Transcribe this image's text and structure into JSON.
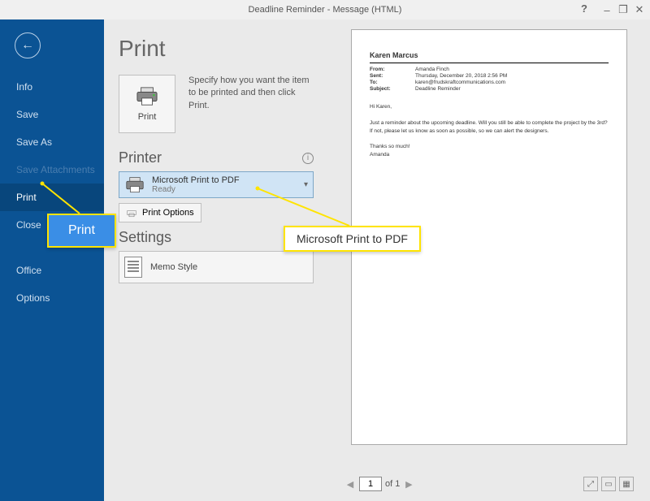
{
  "titlebar": {
    "title": "Deadline Reminder - Message (HTML)",
    "help": "?",
    "min": "–",
    "restore": "❐",
    "close": "✕"
  },
  "sidebar": {
    "back": "←",
    "items": [
      {
        "label": "Info"
      },
      {
        "label": "Save"
      },
      {
        "label": "Save As"
      },
      {
        "label": "Save Attachments"
      },
      {
        "label": "Print"
      },
      {
        "label": "Close"
      },
      {
        "label": "Office "
      },
      {
        "label": "Options"
      }
    ]
  },
  "print": {
    "page_title": "Print",
    "button_label": "Print",
    "help_text": "Specify how you want the item to be printed and then click Print.",
    "printer_header": "Printer",
    "info": "i",
    "selected_printer": {
      "name": "Microsoft Print to PDF",
      "status": "Ready"
    },
    "options_label": "Print Options",
    "settings_header": "Settings",
    "memo_label": "Memo Style"
  },
  "preview": {
    "from_name": "Karen Marcus",
    "headers": {
      "from_label": "From:",
      "from_value": "Amanda Finch",
      "sent_label": "Sent:",
      "sent_value": "Thursday, December 20, 2018 2:56 PM",
      "to_label": "To:",
      "to_value": "karen@frudskraftcommunications.com",
      "subject_label": "Subject:",
      "subject_value": "Deadline Reminder"
    },
    "body": {
      "greeting": "Hi Karen,",
      "para1": "Just a reminder about the upcoming deadline. Will you still be able to complete the project by the 3rd? If not, please let us know as soon as possible, so we can alert the designers.",
      "closing": "Thanks so much!",
      "signature": "Amanda"
    },
    "nav": {
      "prev": "◀",
      "page_value": "1",
      "of_label": "of 1",
      "next": "▶"
    }
  },
  "callouts": {
    "print": "Print",
    "pdf": "Microsoft Print to PDF"
  }
}
